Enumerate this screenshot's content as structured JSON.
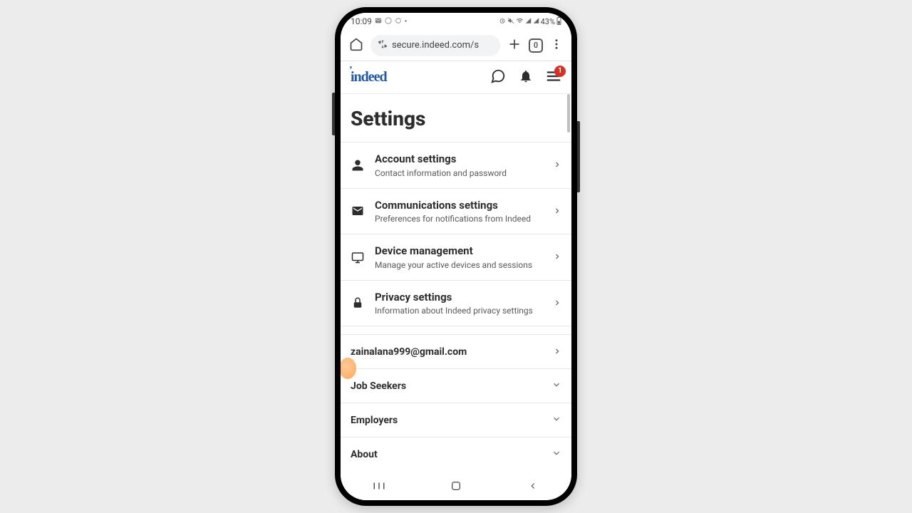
{
  "status_bar": {
    "time": "10:09",
    "battery": "43%"
  },
  "browser": {
    "url": "secure.indeed.com/s",
    "tab_count": "0"
  },
  "header": {
    "logo_text": "indeed",
    "menu_badge": "1"
  },
  "page_title": "Settings",
  "settings": [
    {
      "icon": "person",
      "title": "Account settings",
      "sub": "Contact information and password"
    },
    {
      "icon": "mail",
      "title": "Communications settings",
      "sub": "Preferences for notifications from Indeed"
    },
    {
      "icon": "monitor",
      "title": "Device management",
      "sub": "Manage your active devices and sessions"
    },
    {
      "icon": "lock",
      "title": "Privacy settings",
      "sub": "Information about Indeed privacy settings"
    }
  ],
  "email_row": "zainalana999@gmail.com",
  "accordions": [
    {
      "label": "Job Seekers"
    },
    {
      "label": "Employers"
    },
    {
      "label": "About"
    }
  ]
}
